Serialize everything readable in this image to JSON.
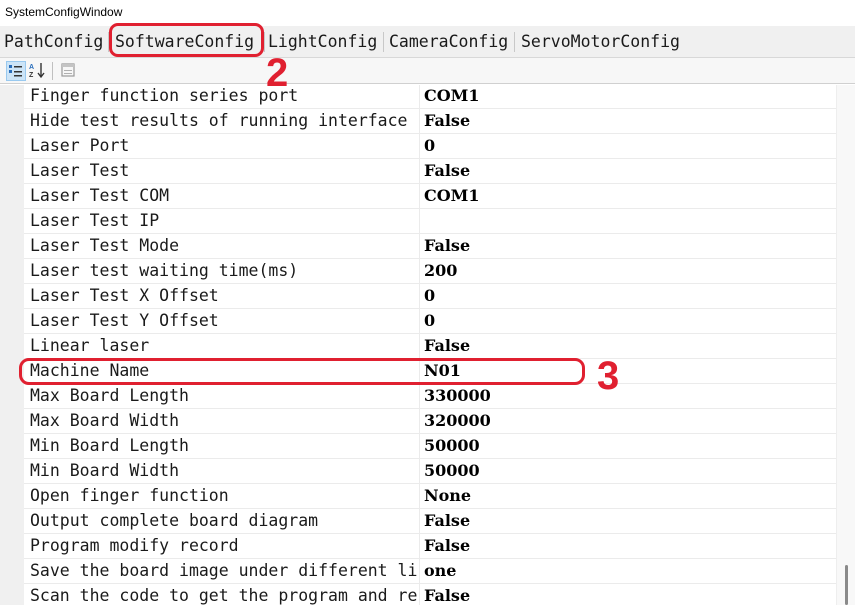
{
  "window": {
    "title": "SystemConfigWindow"
  },
  "tabs": [
    {
      "label": "PathConfig"
    },
    {
      "label": "SoftwareConfig",
      "selected": true
    },
    {
      "label": "LightConfig"
    },
    {
      "label": "CameraConfig"
    },
    {
      "label": "ServoMotorConfig"
    }
  ],
  "toolbar": {
    "categorized_icon": "categorized-icon",
    "alphabetical_icon": "sort-az-icon",
    "property_pages_icon": "property-pages-icon"
  },
  "properties": [
    {
      "name": "Finger function series port",
      "value": "COM1"
    },
    {
      "name": "Hide test results of running interface",
      "value": "False"
    },
    {
      "name": "Laser Port",
      "value": "0"
    },
    {
      "name": "Laser Test",
      "value": "False"
    },
    {
      "name": "Laser Test COM",
      "value": "COM1"
    },
    {
      "name": "Laser Test IP",
      "value": ""
    },
    {
      "name": "Laser Test Mode",
      "value": "False"
    },
    {
      "name": "Laser test waiting time(ms)",
      "value": "200"
    },
    {
      "name": "Laser Test X Offset",
      "value": "0"
    },
    {
      "name": "Laser Test Y Offset",
      "value": "0"
    },
    {
      "name": "Linear laser",
      "value": "False"
    },
    {
      "name": "Machine Name",
      "value": "N01"
    },
    {
      "name": "Max Board Length",
      "value": "330000"
    },
    {
      "name": "Max Board Width",
      "value": "320000"
    },
    {
      "name": "Min Board Length",
      "value": "50000"
    },
    {
      "name": "Min Board Width",
      "value": "50000"
    },
    {
      "name": "Open finger function",
      "value": "None"
    },
    {
      "name": "Output complete board diagram",
      "value": "False"
    },
    {
      "name": "Program modify record",
      "value": "False"
    },
    {
      "name": "Save the board image under different li",
      "value": "one"
    },
    {
      "name": "Scan the code to get the program and re",
      "value": "False"
    }
  ],
  "annotations": {
    "step2": "2",
    "step3": "3"
  },
  "colors": {
    "annotation": "#e02030",
    "selected_toolbar": "#cce4f7"
  }
}
